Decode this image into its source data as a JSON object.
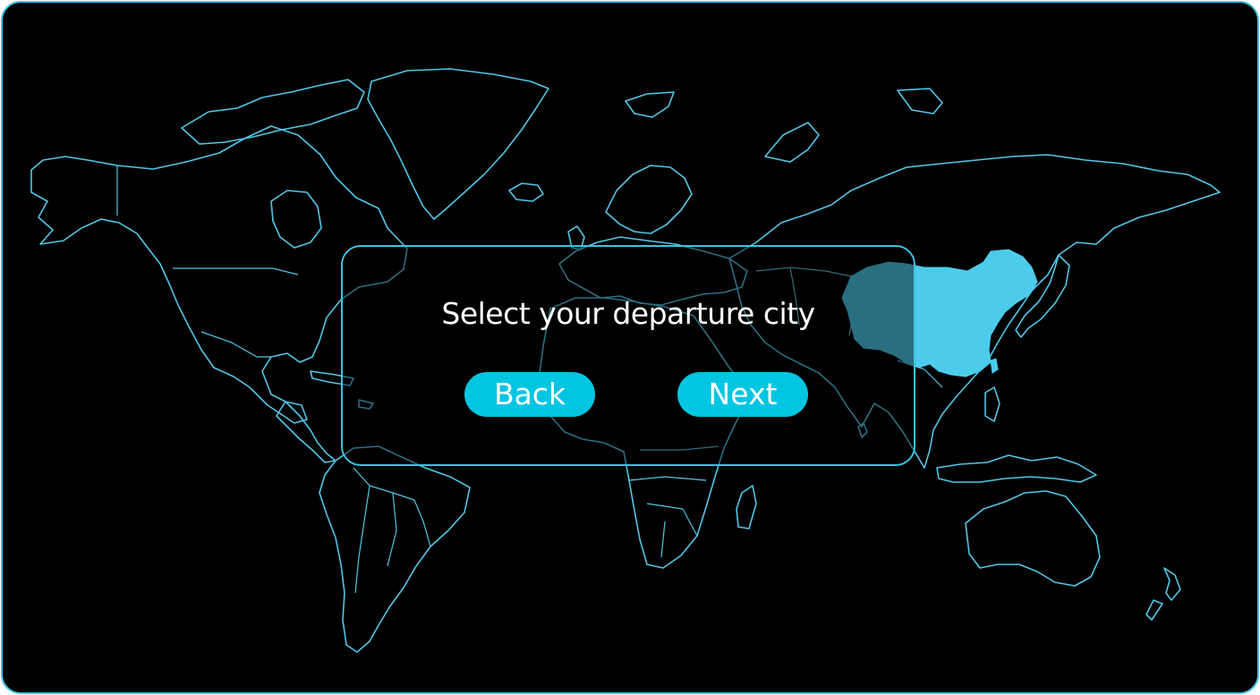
{
  "dialog": {
    "title": "Select your departure city",
    "back_label": "Back",
    "next_label": "Next"
  },
  "map": {
    "highlighted_country": "China",
    "outline_color": "#52c6e6",
    "highlight_color": "#4ccbeb",
    "background_color": "#000000"
  },
  "colors": {
    "accent": "#00c6e2",
    "frame": "#3fc3e0"
  }
}
